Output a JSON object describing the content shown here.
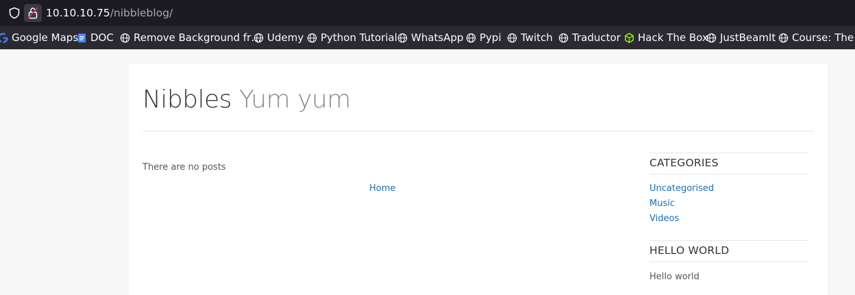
{
  "browser": {
    "url_host": "10.10.10.75",
    "url_path": "/nibbleblog/",
    "bookmarks": [
      {
        "label": "Google Maps",
        "icon": "google-icon"
      },
      {
        "label": "DOC",
        "icon": "docs-icon"
      },
      {
        "label": "Remove Background fr…",
        "icon": "globe-icon"
      },
      {
        "label": "Udemy",
        "icon": "globe-icon"
      },
      {
        "label": "Python Tutorial",
        "icon": "globe-icon"
      },
      {
        "label": "WhatsApp",
        "icon": "globe-icon"
      },
      {
        "label": "Pypi",
        "icon": "globe-icon"
      },
      {
        "label": "Twitch",
        "icon": "globe-icon"
      },
      {
        "label": "Traductor",
        "icon": "globe-icon"
      },
      {
        "label": "Hack The Box",
        "icon": "hackthebox-icon"
      },
      {
        "label": "JustBeamIt",
        "icon": "globe-icon"
      },
      {
        "label": "Course: The Ev",
        "icon": "globe-icon"
      }
    ]
  },
  "blog": {
    "name": "Nibbles",
    "slogan": "Yum yum",
    "no_posts": "There are no posts",
    "home_link": "Home"
  },
  "sidebar": {
    "categories_title": "CATEGORIES",
    "categories": [
      "Uncategorised",
      "Music",
      "Videos"
    ],
    "hello_title": "HELLO WORLD",
    "hello_text": "Hello world"
  },
  "colors": {
    "link": "#1a6fb5",
    "toolbar": "#1c1b22",
    "bookmarks_bar": "#2b2a33"
  }
}
